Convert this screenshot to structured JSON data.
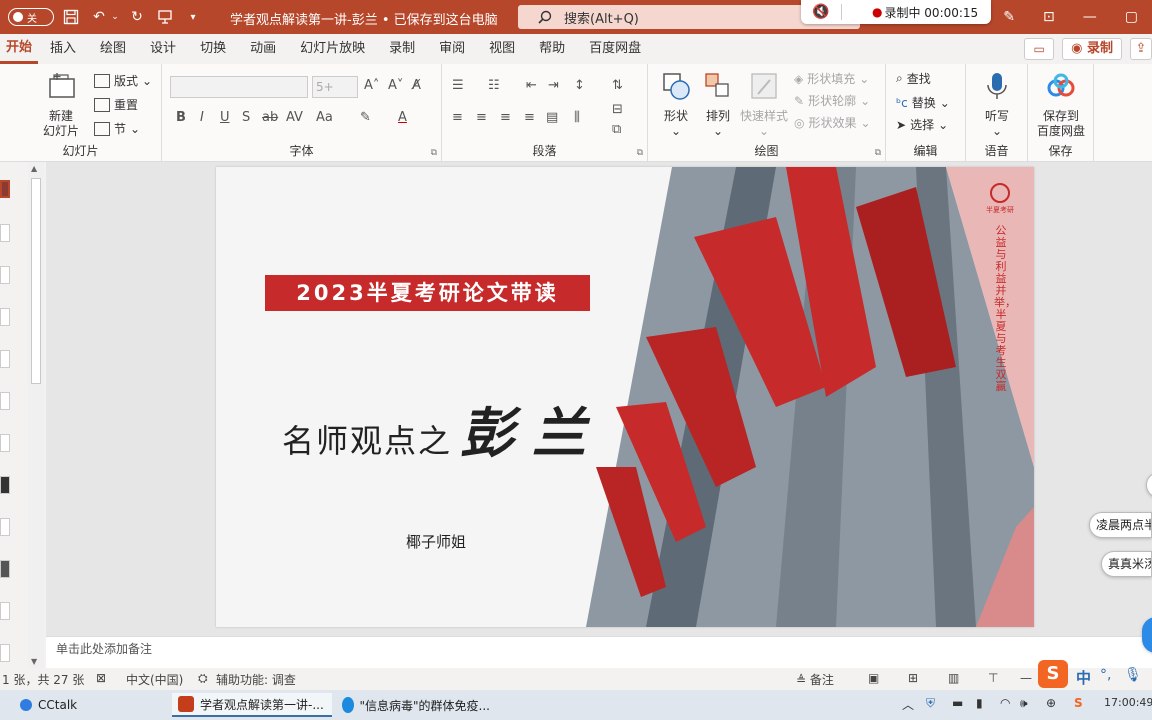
{
  "titlebar": {
    "autosave_label": "关",
    "doc_title": "学者观点解读第一讲-彭兰 • 已保存到这台电脑",
    "search_placeholder": "搜索(Alt+Q)",
    "recording_label": "录制中 00:00:15"
  },
  "tabs": [
    "开始",
    "插入",
    "绘图",
    "设计",
    "切换",
    "动画",
    "幻灯片放映",
    "录制",
    "审阅",
    "视图",
    "帮助",
    "百度网盘"
  ],
  "tab_right": {
    "record": "录制"
  },
  "ribbon": {
    "slides_group": {
      "label": "幻灯片",
      "new_slide": "新建",
      "new_slide2": "幻灯片",
      "layout": "版式",
      "reset": "重置",
      "section": "节"
    },
    "font_group": {
      "label": "字体",
      "size": "5+"
    },
    "paragraph_group": {
      "label": "段落"
    },
    "drawing_group": {
      "label": "绘图",
      "shape": "形状",
      "arrange": "排列",
      "quick_style": "快速样式",
      "fill": "形状填充",
      "outline": "形状轮廓",
      "effect": "形状效果"
    },
    "editing_group": {
      "label": "编辑",
      "find": "查找",
      "replace": "替换",
      "select": "选择"
    },
    "voice_group": {
      "label": "语音",
      "dictate": "听写"
    },
    "save_group": {
      "label": "保存",
      "save": "保存到",
      "save2": "百度网盘"
    }
  },
  "slide": {
    "banner": "2023半夏考研论文带读",
    "title_prefix": "名师观点之",
    "title_name": "彭兰",
    "author": "椰子师姐",
    "slogan": "公益与利益并举，半夏与考生双赢",
    "logo_text": "半夏考研"
  },
  "notes_placeholder": "单击此处添加备注",
  "statusbar": {
    "slide_count": "1 张，共 27 张",
    "language": "中文(中国)",
    "accessibility": "辅助功能: 调查",
    "notes": "备注"
  },
  "taskbar": {
    "apps": [
      "CCtalk",
      "学者观点解读第一讲-...",
      "\"信息病毒\"的群体免疫..."
    ],
    "ime": "中",
    "time": "17:00:49"
  },
  "overlays": {
    "bubble1": "凌晨两点半",
    "bubble2": "真真米汤"
  },
  "colors": {
    "accent": "#b7472a",
    "banner_red": "#c62a2a",
    "taskbar": "#dfe6ee"
  }
}
